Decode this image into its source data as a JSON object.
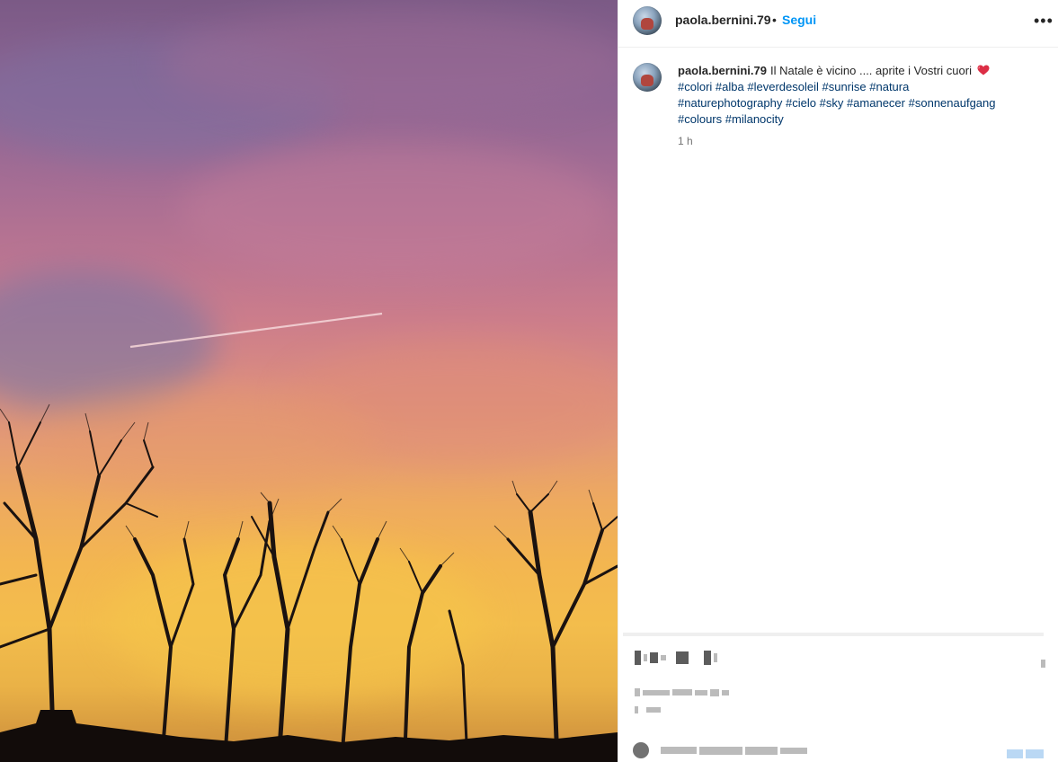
{
  "post": {
    "username": "paola.bernini.79",
    "separator": "•",
    "follow_label": "Segui",
    "more_label": "•••"
  },
  "caption": {
    "username": "paola.bernini.79",
    "text": "Il Natale è vicino .... aprite i Vostri cuori",
    "emoji": "red-heart",
    "hashtags": [
      "#colori",
      "#alba",
      "#leverdesoleil",
      "#sunrise",
      "#natura",
      "#naturephotography",
      "#cielo",
      "#sky",
      "#amanecer",
      "#sonnenaufgang",
      "#colours",
      "#milanocity"
    ],
    "time": "1 h"
  },
  "icons": {
    "more": "more-horizontal-icon",
    "heart": "heart-emoji-icon",
    "avatar": "profile-avatar"
  },
  "colors": {
    "follow_blue": "#0095f6",
    "hashtag_blue": "#00376b",
    "timestamp_gray": "#737373"
  }
}
